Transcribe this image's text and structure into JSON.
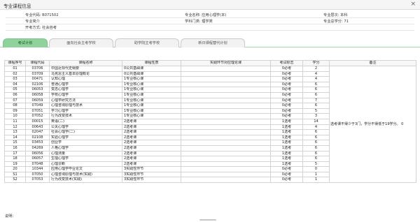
{
  "window": {
    "title": "专业课程信息",
    "close": "×"
  },
  "info": {
    "row1": {
      "code": "专业代码: B071502",
      "name": "专业名称: 应用心理学(本)",
      "level": "专业层次: 本科"
    },
    "row2": {
      "intro": "专业简介",
      "category": "学科门类: 理学类",
      "credits": "专业总学分: 71"
    },
    "row3": {
      "mode": "开考方式: 社会自考"
    }
  },
  "tabs": [
    "考试计划",
    "面向社会主考学校",
    "助学院主考学校",
    "新日课程替代计划"
  ],
  "table": {
    "headers": [
      "课程序号",
      "课程代码",
      "课程名称",
      "课程性质",
      "实践环节对应理论课",
      "考试标志",
      "学分",
      "备注"
    ],
    "rows": [
      [
        "01",
        "03706",
        "中国近现代史纲要",
        "0公共基础课",
        "",
        "0必考",
        "2"
      ],
      [
        "02",
        "03709",
        "马克思主义基本原理概论",
        "0公共基础课",
        "",
        "0必考",
        "4"
      ],
      [
        "03",
        "00471",
        "认知心理",
        "1专业核心课",
        "",
        "0必考",
        "4"
      ],
      [
        "04",
        "02106",
        "普通心理学",
        "1专业核心课",
        "",
        "0必考",
        "6"
      ],
      [
        "05",
        "06053",
        "变态心理学",
        "1专业核心课",
        "",
        "0必考",
        "6"
      ],
      [
        "06",
        "06058",
        "学校心理学",
        "1专业核心课",
        "",
        "0必考",
        "6"
      ],
      [
        "07",
        "06059",
        "心理学研究方法",
        "1专业核心课",
        "",
        "0必考",
        "7"
      ],
      [
        "08",
        "07049",
        "心理咨询原理与技术",
        "1专业核心课",
        "",
        "0必考",
        "6"
      ],
      [
        "09",
        "07051",
        "学习心理学",
        "1专业核心课",
        "",
        "0必考",
        "5"
      ],
      [
        "10",
        "07052",
        "行为改变技术",
        "1专业核心课",
        "",
        "0必考",
        "3"
      ],
      [
        "11",
        "00015",
        "英语(二)",
        "2选考课",
        "",
        "1选考",
        "14"
      ],
      [
        "12",
        "00643",
        "公关心理学",
        "2选考课",
        "",
        "1选考",
        "4"
      ],
      [
        "13",
        "02047",
        "社会心理学(二)",
        "2选考课",
        "",
        "1选考",
        "6"
      ],
      [
        "14",
        "02108",
        "实验心理学",
        "2选考课",
        "",
        "1选考",
        "6"
      ],
      [
        "15",
        "03453",
        "创业学",
        "2选考课",
        "",
        "1选考",
        "6"
      ],
      [
        "16",
        "04269",
        "人格心理学",
        "2选考课",
        "",
        "1选考",
        "6"
      ],
      [
        "17",
        "06056",
        "心理测量",
        "2选考课",
        "",
        "1选考",
        "6"
      ],
      [
        "18",
        "06057",
        "生理心理学",
        "2选考课",
        "",
        "1选考",
        "6"
      ],
      [
        "19",
        "07048",
        "心理诊断",
        "2选考课",
        "",
        "1选考",
        "5"
      ],
      [
        "20",
        "10344",
        "应用心理学毕业论文",
        "3实践性环节",
        "",
        "0必考",
        "0"
      ],
      [
        "S1",
        "07050",
        "心理咨询原理与技术(实践)",
        "3实践性环节",
        "",
        "0必考",
        "1"
      ],
      [
        "S2",
        "07053",
        "行为改变技术(实践)",
        "3实践性环节",
        "",
        "0必考",
        "1"
      ]
    ],
    "remark": "选考课不得少于3门，学分不得低于19学分。 0"
  },
  "footer": {
    "note": "说明："
  }
}
